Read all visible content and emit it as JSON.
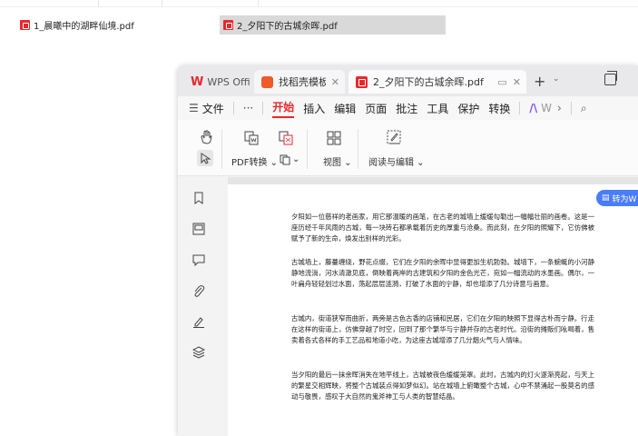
{
  "file_list": [
    {
      "name": "1_晨曦中的湖畔仙境.pdf",
      "selected": false
    },
    {
      "name": "2_夕阳下的古城余晖.pdf",
      "selected": true
    }
  ],
  "app": {
    "tabs": [
      {
        "label": "WPS Office",
        "icon": "wps-logo-icon"
      },
      {
        "label": "找稻壳模板",
        "icon": "docer-icon"
      },
      {
        "label": "2_夕阳下的古城余晖.pdf",
        "icon": "pdf-icon"
      }
    ],
    "new_tab": "+",
    "menu": {
      "file": "文件",
      "more": "···",
      "items": [
        "开始",
        "插入",
        "编辑",
        "页面",
        "批注",
        "工具",
        "保护",
        "转换"
      ],
      "active": "开始",
      "ai_label": "W",
      "search_icon": "search-icon"
    },
    "toolbar": {
      "pdf_convert": "PDF转换",
      "view": "视图",
      "read_edit": "阅读与编辑"
    },
    "convert_button": "转为W"
  },
  "document": {
    "paragraphs": [
      "夕阳如一位慈祥的老画家，用它那温暖的画笔，在古老的城墙上缓缓勾勒出一幅幅壮丽的画卷。这是一座历经千年风雨的古城，每一块砖石都承载着历史的厚重与沧桑。而此刻，在夕阳的照耀下，它仿佛被赋予了新的生命，焕发出别样的光彩。",
      "古城墙上，藤蔓缠绕，野花点缀，它们在夕阳的余晖中显得更加生机勃勃。城墙下，一条蜿蜒的小河静静地流淌，河水清澈见底，倒映着两岸的古建筑和夕阳的金色光芒，宛如一幅流动的水墨画。偶尔，一叶扁舟轻轻划过水面，荡起层层涟漪，打破了水面的宁静，却也增添了几分诗意与画意。",
      "古城内，街道狭窄而曲折，两旁是古色古香的店铺和民居，它们在夕阳的映照下显得古朴而宁静。行走在这样的街道上，仿佛穿越了时空，回到了那个繁华与宁静并存的古老时代。沿街的摊贩们吆喝着，售卖着各式各样的手工艺品和地道小吃，为这座古城增添了几分烟火气与人情味。",
      "当夕阳的最后一抹余晖消失在地平线上，古城被夜色缓缓笼罩。此时，古城内的灯火逐渐亮起，与天上的繁星交相辉映，将整个古城装点得如梦似幻。站在城墙上俯瞰整个古城，心中不禁涌起一股莫名的感动与敬畏，感叹于大自然的鬼斧神工与人类的智慧结晶。"
    ]
  }
}
